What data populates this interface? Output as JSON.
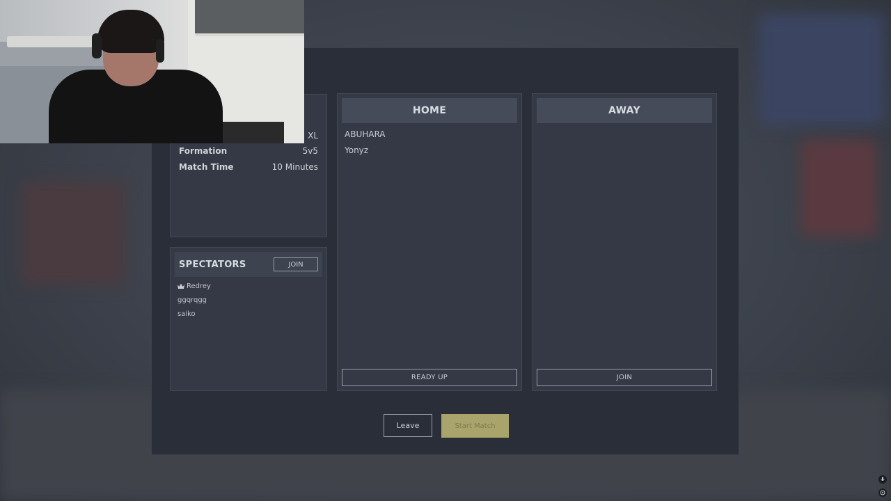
{
  "settings": {
    "rows": [
      {
        "label": "",
        "value": "XL"
      },
      {
        "label": "Formation",
        "value": "5v5"
      },
      {
        "label": "Match Time",
        "value": "10 Minutes"
      }
    ]
  },
  "spectators": {
    "title": "SPECTATORS",
    "join_label": "JOIN",
    "list": [
      "Redrey",
      "ggqrqgg",
      "saiko"
    ]
  },
  "home": {
    "title": "HOME",
    "players": [
      "ABUHARA",
      "Yonyz"
    ],
    "button_label": "READY UP"
  },
  "away": {
    "title": "AWAY",
    "players": [],
    "button_label": "JOIN"
  },
  "footer": {
    "leave_label": "Leave",
    "start_label": "Start Match"
  },
  "hud": {
    "icons": [
      "microphone-icon",
      "settings-icon"
    ]
  },
  "colors": {
    "start_button": "#a9a46c",
    "panel": "#2a2e38"
  }
}
